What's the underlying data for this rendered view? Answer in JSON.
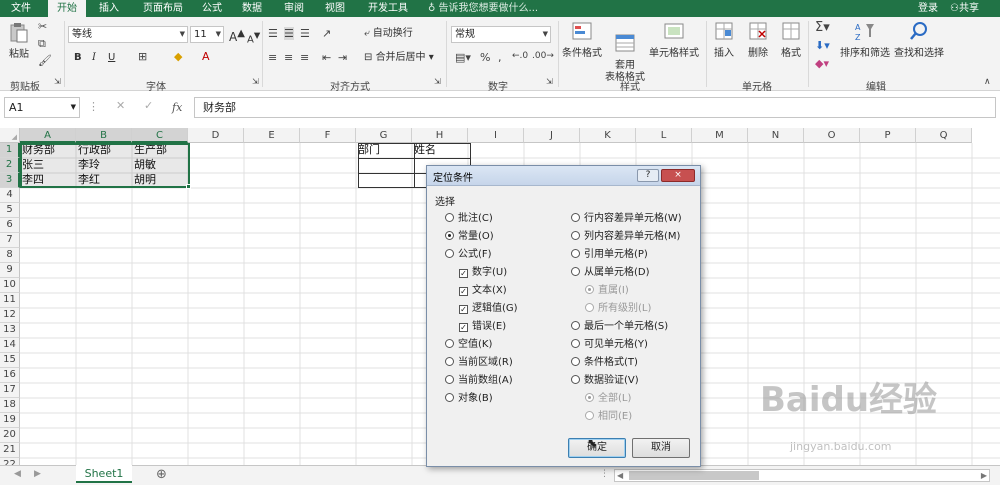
{
  "tabs": [
    "文件",
    "开始",
    "插入",
    "页面布局",
    "公式",
    "数据",
    "审阅",
    "视图",
    "开发工具"
  ],
  "active_tab": "开始",
  "tell_me": "告诉我您想要做什么...",
  "login": "登录",
  "share": "共享",
  "ribbon": {
    "clipboard": {
      "paste": "粘贴",
      "label": "剪贴板"
    },
    "font": {
      "name": "等线",
      "size": "11",
      "bold": "B",
      "italic": "I",
      "underline": "U",
      "label": "字体",
      "grow": "A",
      "shrink": "A"
    },
    "alignment": {
      "wrap": "自动换行",
      "merge": "合并后居中",
      "label": "对齐方式"
    },
    "number": {
      "format": "常规",
      "label": "数字"
    },
    "styles": {
      "cond": "条件格式",
      "table": "套用\n表格格式",
      "cell": "单元格样式",
      "label": "样式"
    },
    "cells": {
      "insert": "插入",
      "delete": "删除",
      "format": "格式",
      "label": "单元格"
    },
    "editing": {
      "sort": "排序和筛选",
      "find": "查找和选择",
      "label": "编辑"
    }
  },
  "formula_bar": {
    "name_box": "A1",
    "fx": "fx",
    "content": "财务部"
  },
  "columns": [
    "A",
    "B",
    "C",
    "D",
    "E",
    "F",
    "G",
    "H",
    "I",
    "J",
    "K",
    "L",
    "M",
    "N",
    "O",
    "P",
    "Q"
  ],
  "rows": [
    "1",
    "2",
    "3",
    "4",
    "5",
    "6",
    "7",
    "8",
    "9",
    "10",
    "11",
    "12",
    "13",
    "14",
    "15",
    "16",
    "17",
    "18",
    "19",
    "20",
    "21",
    "22"
  ],
  "cells": {
    "A1": "财务部",
    "B1": "行政部",
    "C1": "生产部",
    "A2": "张三",
    "B2": "李玲",
    "C2": "胡敏",
    "A3": "李四",
    "B3": "李红",
    "C3": "胡明",
    "G1": "部门",
    "H1": "姓名"
  },
  "sheet_tab": "Sheet1",
  "dialog": {
    "title": "定位条件",
    "help": "?",
    "close": "×",
    "select_label": "选择",
    "left_options": [
      {
        "label": "批注(C)",
        "type": "radio",
        "checked": false
      },
      {
        "label": "常量(O)",
        "type": "radio",
        "checked": true
      },
      {
        "label": "公式(F)",
        "type": "radio",
        "checked": false
      },
      {
        "label": "数字(U)",
        "type": "check",
        "checked": true
      },
      {
        "label": "文本(X)",
        "type": "check",
        "checked": true
      },
      {
        "label": "逻辑值(G)",
        "type": "check",
        "checked": true
      },
      {
        "label": "错误(E)",
        "type": "check",
        "checked": true
      },
      {
        "label": "空值(K)",
        "type": "radio",
        "checked": false
      },
      {
        "label": "当前区域(R)",
        "type": "radio",
        "checked": false
      },
      {
        "label": "当前数组(A)",
        "type": "radio",
        "checked": false
      },
      {
        "label": "对象(B)",
        "type": "radio",
        "checked": false
      }
    ],
    "right_options": [
      {
        "label": "行内容差异单元格(W)",
        "type": "radio",
        "checked": false,
        "disabled": false
      },
      {
        "label": "列内容差异单元格(M)",
        "type": "radio",
        "checked": false,
        "disabled": false
      },
      {
        "label": "引用单元格(P)",
        "type": "radio",
        "checked": false,
        "disabled": false
      },
      {
        "label": "从属单元格(D)",
        "type": "radio",
        "checked": false,
        "disabled": false
      },
      {
        "label": "直属(I)",
        "type": "radio",
        "checked": true,
        "disabled": true
      },
      {
        "label": "所有级别(L)",
        "type": "radio",
        "checked": false,
        "disabled": true
      },
      {
        "label": "最后一个单元格(S)",
        "type": "radio",
        "checked": false,
        "disabled": false
      },
      {
        "label": "可见单元格(Y)",
        "type": "radio",
        "checked": false,
        "disabled": false
      },
      {
        "label": "条件格式(T)",
        "type": "radio",
        "checked": false,
        "disabled": false
      },
      {
        "label": "数据验证(V)",
        "type": "radio",
        "checked": false,
        "disabled": false
      },
      {
        "label": "全部(L)",
        "type": "radio",
        "checked": true,
        "disabled": true
      },
      {
        "label": "相同(E)",
        "type": "radio",
        "checked": false,
        "disabled": true
      }
    ],
    "ok": "确定",
    "cancel": "取消"
  },
  "watermark": "Baidu经验",
  "watermark_url": "jingyan.baidu.com",
  "colors": {
    "accent": "#217346",
    "selection_fill": "#d3d3d3"
  }
}
